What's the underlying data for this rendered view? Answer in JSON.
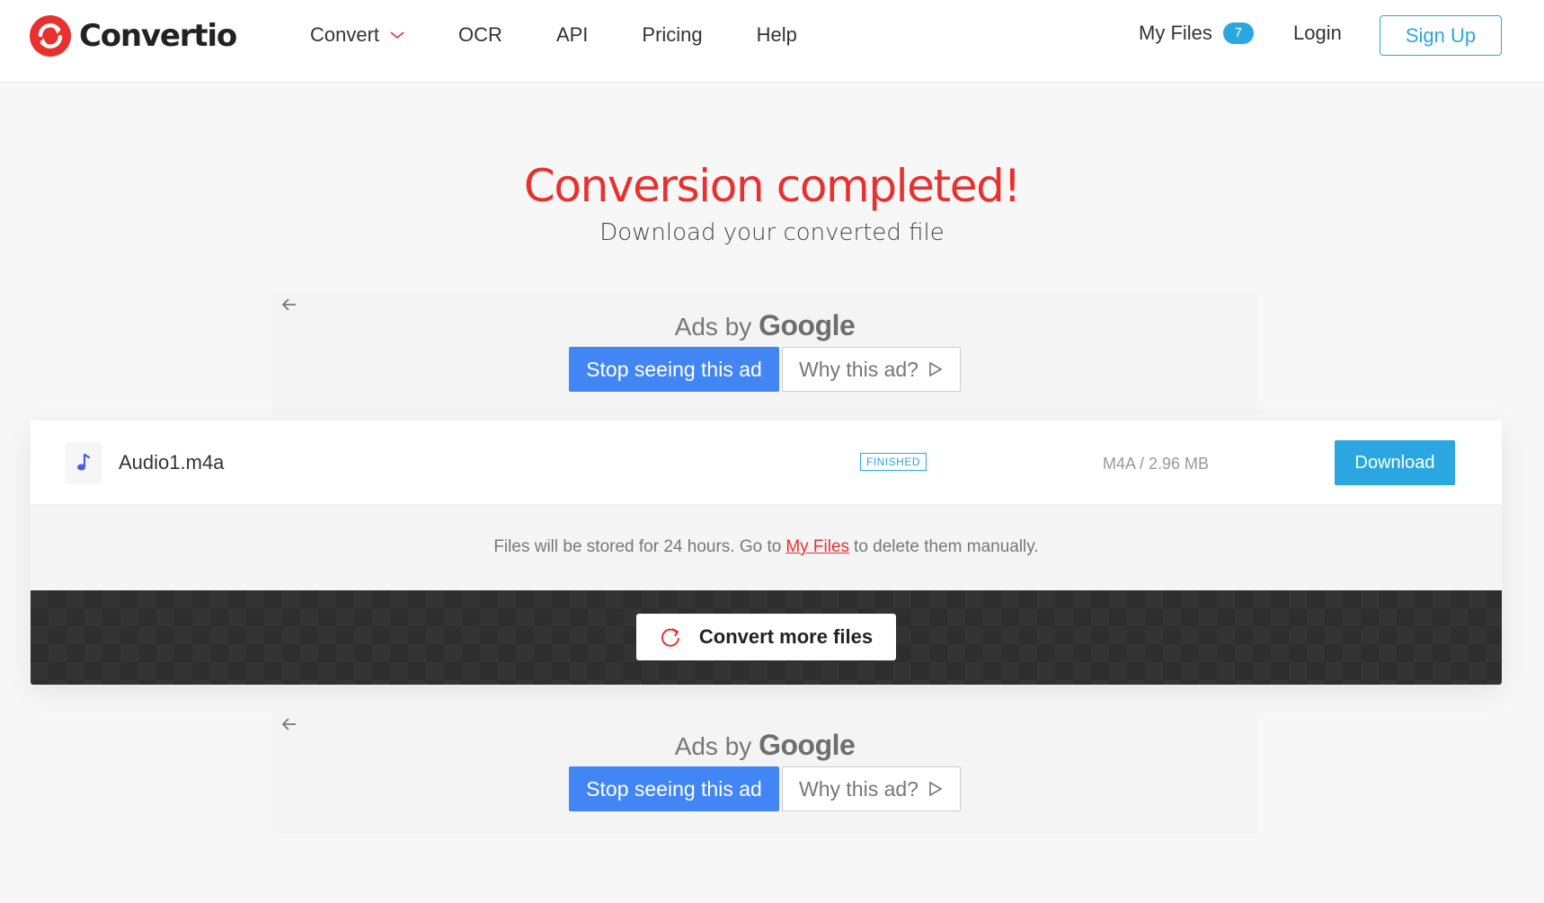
{
  "brand": {
    "name": "Convertio",
    "accent": "#e8312f"
  },
  "nav": {
    "items": [
      {
        "label": "Convert",
        "has_dropdown": true
      },
      {
        "label": "OCR"
      },
      {
        "label": "API"
      },
      {
        "label": "Pricing"
      },
      {
        "label": "Help"
      }
    ],
    "my_files_label": "My Files",
    "my_files_count": "7",
    "login_label": "Login",
    "signup_label": "Sign Up"
  },
  "main": {
    "title": "Conversion completed!",
    "subtitle": "Download your converted file"
  },
  "ads": {
    "ads_by": "Ads by",
    "google": "Google",
    "stop_label": "Stop seeing this ad",
    "why_label": "Why this ad?"
  },
  "file": {
    "name": "Audio1.m4a",
    "status": "FINISHED",
    "meta": "M4A / 2.96 MB",
    "download_label": "Download"
  },
  "notice": {
    "before": "Files will be stored for 24 hours. Go to",
    "link": "My Files",
    "after": "to delete them manually."
  },
  "convert_more_label": "Convert more files",
  "colors": {
    "primary_blue": "#2aa7e0",
    "google_blue": "#4285f4",
    "dark_band": "#343434"
  }
}
